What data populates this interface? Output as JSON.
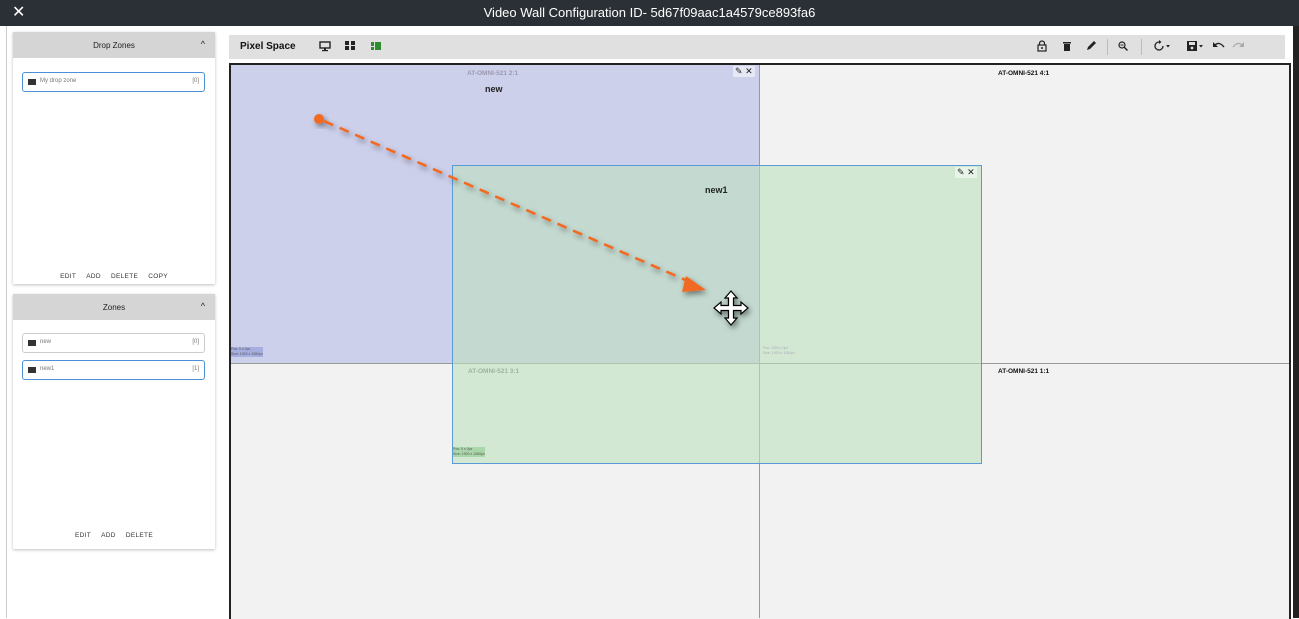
{
  "window": {
    "title": "Video Wall Configuration ID- 5d67f09aac1a4579ce893fa6",
    "close_icon": "close-icon"
  },
  "drop_zones_panel": {
    "title": "Drop Zones",
    "items": [
      {
        "name": "My drop zone",
        "count": "[0]",
        "selected": true
      }
    ],
    "actions": [
      "EDIT",
      "ADD",
      "DELETE",
      "COPY"
    ]
  },
  "zones_panel": {
    "title": "Zones",
    "items": [
      {
        "name": "new",
        "count": "[0]",
        "selected": false
      },
      {
        "name": "new1",
        "count": "[1]",
        "selected": true
      }
    ],
    "actions": [
      "EDIT",
      "ADD",
      "DELETE"
    ]
  },
  "toolbar": {
    "title": "Pixel Space",
    "left_icons": [
      "monitor-icon",
      "grid-icon",
      "layout-icon"
    ],
    "right_icons": [
      "lock-icon",
      "delete-icon",
      "edit-icon",
      "zoom-icon",
      "refresh-dropdown-icon",
      "save-dropdown-icon",
      "undo-icon",
      "redo-icon"
    ]
  },
  "displays": [
    {
      "label": "AT-OMNI-521 2:1"
    },
    {
      "label": "AT-OMNI-521 4:1"
    },
    {
      "label": "AT-OMNI-521 3:1"
    },
    {
      "label": "AT-OMNI-521 1:1"
    }
  ],
  "zones": [
    {
      "name": "new",
      "pos": "Pos: 0 x 0px",
      "size": "Size: 1920 x 1080px",
      "color": "#afb4e6"
    },
    {
      "name": "new1",
      "pos": "Pos: 0 x 0px",
      "size": "Size: 1920 x 1080px",
      "color": "#bee1be"
    }
  ],
  "ghost_posinfo": [
    {
      "pos": "Pos: 1920 x 0px",
      "size": "Size: 1920 x 1080px"
    }
  ],
  "colors": {
    "accent_orange": "#f26b21",
    "selection_blue": "#4a90d9",
    "titlebar": "#2a3035"
  }
}
